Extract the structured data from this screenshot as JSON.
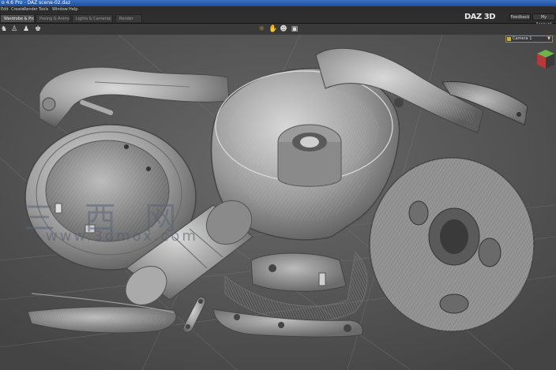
{
  "window": {
    "title": "o 4.6 Pro - DAZ scene-02.daz"
  },
  "menu": {
    "items": [
      "Edit",
      "Create",
      "Render",
      "Tools",
      "Window",
      "Help"
    ]
  },
  "tabs": [
    {
      "label": "Wardrobe & Props",
      "active": true
    },
    {
      "label": "Posing & Animation",
      "active": false
    },
    {
      "label": "Lights & Cameras",
      "active": false
    },
    {
      "label": "Render",
      "active": false
    }
  ],
  "brand": {
    "logo": "DAZ 3D"
  },
  "top_buttons": {
    "feedback": "Feedback",
    "account": "My Account"
  },
  "toolbar": {
    "left_icons": [
      "figure-icon",
      "figure-props-icon",
      "group-figure-icon",
      "figure-sit-icon"
    ],
    "center_icons": [
      "lamp-icon",
      "hand-icon",
      "person-icon",
      "camera-icon"
    ]
  },
  "viewport": {
    "camera_selector": "Camera 1",
    "watermark_text": "三 西 网",
    "watermark_url": "www.3dmox.com"
  },
  "colors": {
    "viewport_bg": "#5a5a5a",
    "accent": "#e8a43a",
    "mesh": "#c8c8c8"
  }
}
